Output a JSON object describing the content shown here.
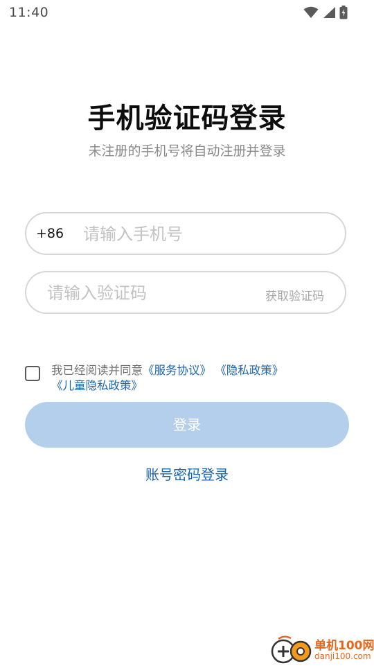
{
  "status_bar": {
    "time": "11:40",
    "icons": [
      "wifi-icon",
      "signal-icon",
      "battery-charging-icon"
    ]
  },
  "header": {
    "title": "手机验证码登录",
    "subtitle": "未注册的手机号将自动注册并登录"
  },
  "phone_field": {
    "prefix": "+86",
    "placeholder": "请输入手机号",
    "value": ""
  },
  "code_field": {
    "placeholder": "请输入验证码",
    "value": "",
    "get_code_label": "获取验证码"
  },
  "agreement": {
    "checked": false,
    "prefix_text": "我已经阅读并同意",
    "service_link": "《服务协议》",
    "privacy_link": "《隐私政策》",
    "child_privacy_link": "《儿童隐私政策》"
  },
  "actions": {
    "login_label": "登录",
    "password_login_label": "账号密码登录"
  },
  "colors": {
    "accent": "#1a66b0",
    "login_button_disabled": "#b3cfeb",
    "watermark": "#e8671b"
  },
  "watermark": {
    "title": "单机100网",
    "url": "danji100.com"
  }
}
